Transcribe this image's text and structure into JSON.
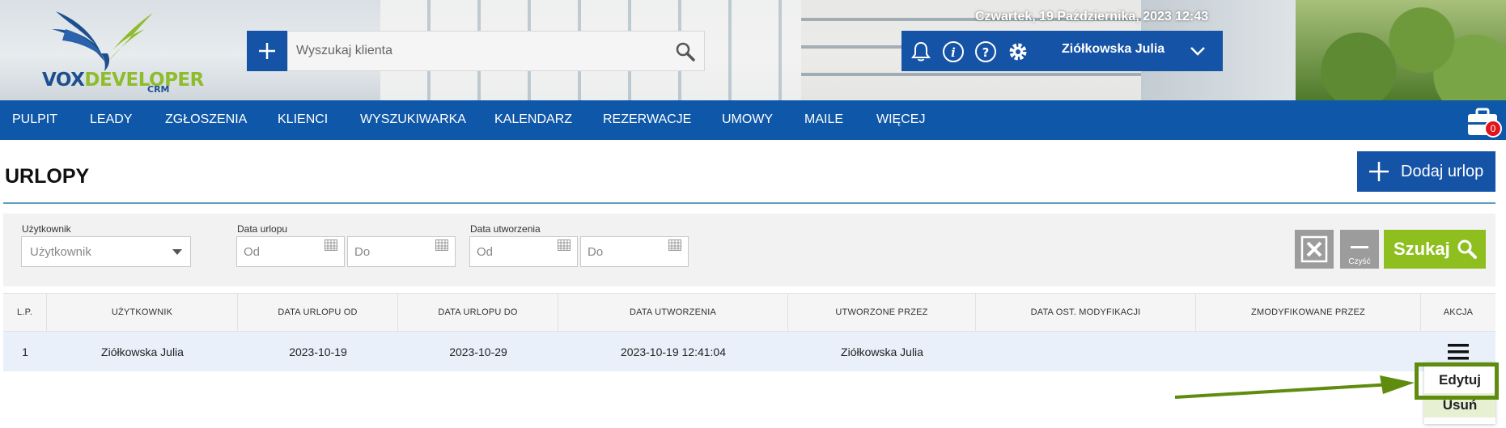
{
  "header": {
    "logo": {
      "brand_left": "VOX",
      "brand_right": "DEVELOPER",
      "sub": "CRM"
    },
    "search": {
      "placeholder": "Wyszukaj klienta"
    },
    "datetime": "Czwartek, 19 Października, 2023   12:43",
    "user": {
      "name": "Ziółkowska Julia"
    },
    "icons": [
      "plus-icon",
      "search-icon",
      "bell-icon",
      "info-icon",
      "help-icon",
      "gear-icon",
      "chevron-down-icon"
    ]
  },
  "nav": {
    "items": [
      "PULPIT",
      "LEADY",
      "ZGŁOSZENIA",
      "KLIENCI",
      "WYSZUKIWARKA",
      "KALENDARZ",
      "REZERWACJE",
      "UMOWY",
      "MAILE",
      "WIĘCEJ"
    ],
    "cart_badge": "0"
  },
  "page": {
    "title": "URLOPY",
    "add_button": "Dodaj urlop"
  },
  "filters": {
    "user": {
      "label": "Użytkownik",
      "placeholder": "Użytkownik"
    },
    "date_leave": {
      "label": "Data urlopu",
      "from_placeholder": "Od",
      "to_placeholder": "Do"
    },
    "date_created": {
      "label": "Data utworzenia",
      "from_placeholder": "Od",
      "to_placeholder": "Do"
    },
    "clear_label": "Czyść",
    "search_label": "Szukaj"
  },
  "table": {
    "columns": [
      "L.P.",
      "UŻYTKOWNIK",
      "DATA URLOPU OD",
      "DATA URLOPU DO",
      "DATA UTWORZENIA",
      "UTWORZONE PRZEZ",
      "DATA OST. MODYFIKACJI",
      "ZMODYFIKOWANE PRZEZ",
      "AKCJA"
    ],
    "rows": [
      {
        "lp": "1",
        "user": "Ziółkowska Julia",
        "from": "2023-10-19",
        "to": "2023-10-29",
        "created": "2023-10-19 12:41:04",
        "created_by": "Ziółkowska Julia",
        "modified": "",
        "modified_by": ""
      }
    ]
  },
  "action_menu": {
    "edit": "Edytuj",
    "delete": "Usuń"
  },
  "colors": {
    "primary": "#1553a6",
    "nav": "#0f57a8",
    "accent_green": "#8fbf1f",
    "highlight": "#5f8c0e",
    "badge": "#e0141c"
  }
}
